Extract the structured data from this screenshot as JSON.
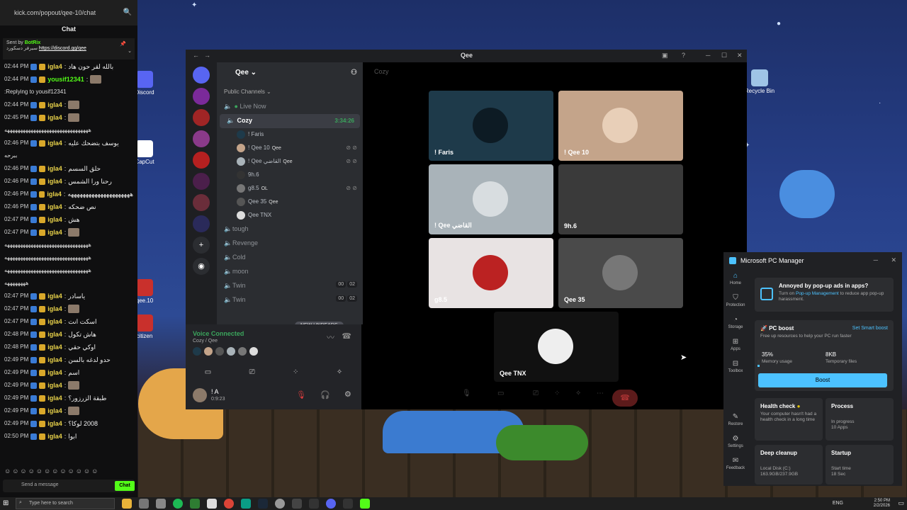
{
  "browser": {
    "url": "kick.com/popout/qee-10/chat"
  },
  "chat": {
    "header": "Chat",
    "pinned_sender_prefix": "Sent by",
    "pinned_sender": "BotRix",
    "pinned_text": "سيرفر دسكورد",
    "pinned_link": "https://discord.gg/qee",
    "messages": [
      {
        "time": "02:44 PM",
        "user": "igla4",
        "text": "بالله لقر حون هاد"
      },
      {
        "time": "02:44 PM",
        "user": "yousif12341",
        "text": ""
      },
      {
        "time": "",
        "user": "",
        "text": "Replying to yousif12341:"
      },
      {
        "time": "02:44 PM",
        "user": "igla4",
        "text": ""
      },
      {
        "time": "02:45 PM",
        "user": "igla4",
        "text": ""
      },
      {
        "time": "",
        "user": "",
        "text": "ههههههههههههههههههههههههههههههههه"
      },
      {
        "time": "02:46 PM",
        "user": "igla4",
        "text": "يوسف بتضحك عليه"
      },
      {
        "time": "",
        "user": "",
        "text": "ببرحه"
      },
      {
        "time": "02:46 PM",
        "user": "igla4",
        "text": "حلق السسم"
      },
      {
        "time": "02:46 PM",
        "user": "igla4",
        "text": "رحنا ورا الشمس"
      },
      {
        "time": "02:46 PM",
        "user": "igla4",
        "text": "هههههههههههههههههههههه"
      },
      {
        "time": "02:46 PM",
        "user": "igla4",
        "text": "نص ضحكه"
      },
      {
        "time": "02:47 PM",
        "user": "igla4",
        "text": "هش"
      },
      {
        "time": "02:47 PM",
        "user": "igla4",
        "text": ""
      },
      {
        "time": "",
        "user": "",
        "text": "ههههههههههههههههههههههههههههههههه"
      },
      {
        "time": "",
        "user": "",
        "text": "ههههههههههههههههههههههههههههههههه"
      },
      {
        "time": "",
        "user": "",
        "text": "ههههههههههههههههههههههههههههههههه"
      },
      {
        "time": "",
        "user": "",
        "text": "ههههههههه"
      },
      {
        "time": "02:47 PM",
        "user": "igla4",
        "text": "ياسادر"
      },
      {
        "time": "02:47 PM",
        "user": "igla4",
        "text": ""
      },
      {
        "time": "02:47 PM",
        "user": "igla4",
        "text": "اسكت انت"
      },
      {
        "time": "02:48 PM",
        "user": "igla4",
        "text": "هاش تكول"
      },
      {
        "time": "02:48 PM",
        "user": "igla4",
        "text": "اوكي حقي"
      },
      {
        "time": "02:49 PM",
        "user": "igla4",
        "text": "حدو لدغه بالسن"
      },
      {
        "time": "02:49 PM",
        "user": "igla4",
        "text": "اسم"
      },
      {
        "time": "02:49 PM",
        "user": "igla4",
        "text": ""
      },
      {
        "time": "02:49 PM",
        "user": "igla4",
        "text": "طبقة الزرزور؟"
      },
      {
        "time": "02:49 PM",
        "user": "igla4",
        "text": ""
      },
      {
        "time": "02:49 PM",
        "user": "igla4",
        "text": "2008 لوكا؟"
      },
      {
        "time": "02:50 PM",
        "user": "igla4",
        "text": "ابوا"
      }
    ],
    "input_placeholder": "Send a message",
    "send_label": "Chat"
  },
  "desktop_icons": [
    {
      "label": "Discord",
      "color": "#5865f2"
    },
    {
      "label": "CapCut",
      "color": "#ffffff"
    },
    {
      "label": "qee.10",
      "color": "#c9302c"
    },
    {
      "label": "citizen",
      "color": "#c9302c"
    },
    {
      "label": "Recycle Bin",
      "color": "#9fc4e6"
    }
  ],
  "discord": {
    "window_title": "Qee",
    "server_name": "Qee",
    "category": "Public Channels",
    "channels": [
      {
        "name": "Live Now",
        "active": false,
        "timer": ""
      },
      {
        "name": "Cozy",
        "active": true,
        "timer": "3:34:26"
      }
    ],
    "voice_users": [
      {
        "name": "! Faris",
        "tag": "",
        "muted": false
      },
      {
        "name": "! Qee 10",
        "tag": "Qee",
        "muted": true
      },
      {
        "name": "! Qee القاضي",
        "tag": "Qee",
        "muted": true
      },
      {
        "name": "9h.6",
        "tag": "",
        "muted": false
      },
      {
        "name": "g8.5",
        "tag": "OL",
        "muted": true
      },
      {
        "name": "Qee 35",
        "tag": "Qee",
        "muted": false
      },
      {
        "name": "Qee TNX",
        "tag": "",
        "muted": false
      }
    ],
    "other_channels": [
      {
        "name": "tough",
        "count_a": "",
        "count_b": ""
      },
      {
        "name": "Revenge",
        "count_a": "",
        "count_b": ""
      },
      {
        "name": "Cold",
        "count_a": "",
        "count_b": ""
      },
      {
        "name": "moon",
        "count_a": "",
        "count_b": ""
      },
      {
        "name": "Twin",
        "count_a": "00",
        "count_b": "02"
      },
      {
        "name": "Twin",
        "count_a": "00",
        "count_b": "02"
      }
    ],
    "new_unreads": "NEW UNREADS",
    "voice_connected": "Voice Connected",
    "voice_location": "Cozy / Qee",
    "self_name": "! A",
    "self_status": "0:9:23",
    "stage_channel": "Cozy",
    "tiles": [
      {
        "label": "! Faris",
        "bg": "#1e3a4a"
      },
      {
        "label": "! Qee 10",
        "bg": "#c4a48a"
      },
      {
        "label": "! Qee القاضي",
        "bg": "#a9b3b9"
      },
      {
        "label": "9h.6",
        "bg": "#3a3a3a"
      },
      {
        "label": "g8.5",
        "bg": "#e8e3e3"
      },
      {
        "label": "Qee 35",
        "bg": "#4a4a4a"
      },
      {
        "label": "Qee TNX",
        "bg": "#111111"
      }
    ]
  },
  "pc_manager": {
    "title": "Microsoft PC Manager",
    "nav": [
      "Home",
      "Protection",
      "Storage",
      "Apps",
      "Toolbox",
      "Restore",
      "Settings",
      "Feedback"
    ],
    "popup_title": "Annoyed by pop-up ads in apps?",
    "popup_text_a": "Turn on",
    "popup_link": "Pop-up Management",
    "popup_text_b": "to reduce app pop-up harassment.",
    "boost_title": "PC boost",
    "smart_boost": "Set Smart boost",
    "boost_desc": "Free up resources to help your PC run faster",
    "memory_value": "35%",
    "memory_label": "Memory usage",
    "memory_fraction": 0.35,
    "temp_value": "8KB",
    "temp_label": "Temporary files",
    "boost_button": "Boost",
    "health_title": "Health check",
    "health_text": "Your computer hasn't had a health check in a long time",
    "process_title": "Process",
    "process_status": "In progress",
    "process_apps": "10 Apps",
    "cleanup_title": "Deep cleanup",
    "cleanup_disk": "Local Disk (C:)",
    "cleanup_size": "163.9GB/237.9GB",
    "startup_title": "Startup",
    "startup_label": "Start time",
    "startup_value": "18 Sec"
  },
  "taskbar": {
    "search_placeholder": "Type here to search",
    "lang": "ENG",
    "time": "2:50 PM",
    "date": "2/2/2026"
  }
}
